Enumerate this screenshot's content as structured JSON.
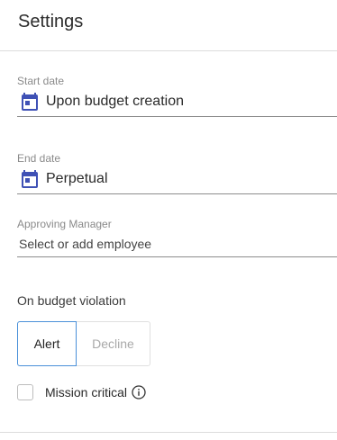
{
  "header": {
    "title": "Settings"
  },
  "start_date": {
    "label": "Start date",
    "value": "Upon budget creation",
    "icon": "calendar-icon"
  },
  "end_date": {
    "label": "End date",
    "value": "Perpetual",
    "icon": "calendar-icon"
  },
  "approving_manager": {
    "label": "Approving Manager",
    "placeholder": "Select or add employee"
  },
  "budget_violation": {
    "label": "On budget violation",
    "options": [
      "Alert",
      "Decline"
    ],
    "selected": "Alert"
  },
  "mission_critical": {
    "label": "Mission critical",
    "checked": false,
    "icon": "info-icon"
  },
  "colors": {
    "icon_blue": "#3f51b5",
    "selected_border": "#4a90d9"
  }
}
